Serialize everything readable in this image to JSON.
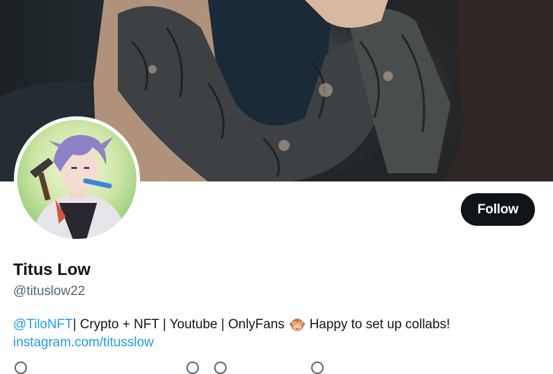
{
  "profile": {
    "display_name": "Titus Low",
    "handle": "@tituslow22",
    "follow_label": "Follow"
  },
  "bio": {
    "mention": "@TiloNFT",
    "text_before_emoji": " | Crypto + NFT | Youtube | OnlyFans",
    "emoji": "see-no-evil-monkey",
    "text_after_emoji": "Happy to set up collabs!",
    "website": "instagram.com/titusslow"
  },
  "colors": {
    "follow_button_bg": "#0f1419",
    "link": "#1d9bf0",
    "secondary_text": "#536471"
  }
}
